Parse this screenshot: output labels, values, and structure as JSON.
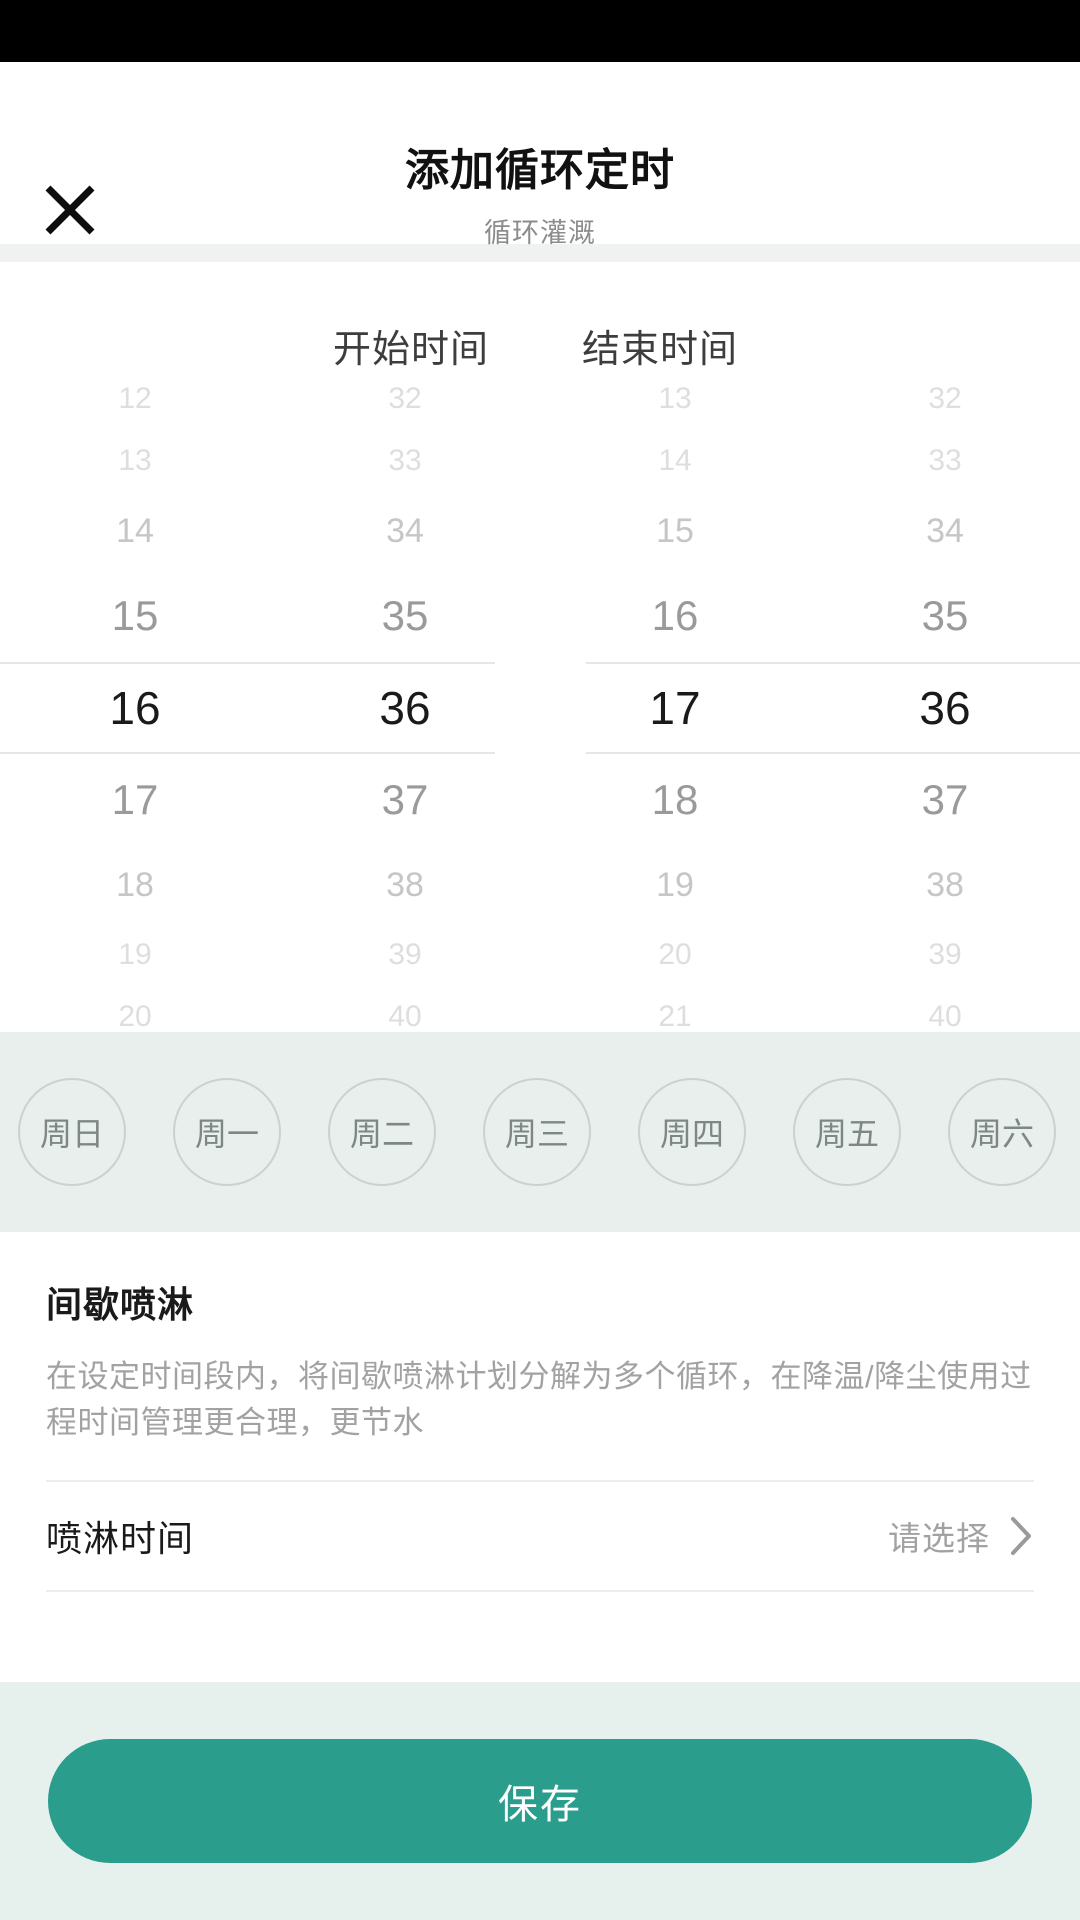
{
  "header": {
    "title": "添加循环定时",
    "subtitle": "循环灌溉",
    "close_icon": "close-icon"
  },
  "picker": {
    "start_label": "开始时间",
    "end_label": "结束时间",
    "start": {
      "hour_selected": "16",
      "minute_selected": "36",
      "hours": [
        "12",
        "13",
        "14",
        "15",
        "16",
        "17",
        "18",
        "19",
        "20"
      ],
      "minutes": [
        "32",
        "33",
        "34",
        "35",
        "36",
        "37",
        "38",
        "39",
        "40"
      ]
    },
    "end": {
      "hour_selected": "17",
      "minute_selected": "36",
      "hours": [
        "13",
        "14",
        "15",
        "16",
        "17",
        "18",
        "19",
        "20",
        "21"
      ],
      "minutes": [
        "32",
        "33",
        "34",
        "35",
        "36",
        "37",
        "38",
        "39",
        "40"
      ]
    }
  },
  "weekdays": {
    "items": [
      {
        "label": "周日",
        "selected": false
      },
      {
        "label": "周一",
        "selected": false
      },
      {
        "label": "周二",
        "selected": false
      },
      {
        "label": "周三",
        "selected": false
      },
      {
        "label": "周四",
        "selected": false
      },
      {
        "label": "周五",
        "selected": false
      },
      {
        "label": "周六",
        "selected": false
      }
    ]
  },
  "spray": {
    "title": "间歇喷淋",
    "description": "在设定时间段内，将间歇喷淋计划分解为多个循环，在降温/降尘使用过程时间管理更合理，更节水",
    "row_label": "喷淋时间",
    "row_value": "请选择",
    "chevron_icon": "chevron-right-icon"
  },
  "footer": {
    "save_label": "保存"
  },
  "colors": {
    "accent": "#2a9d8c",
    "footer_bg": "#e6f1ed",
    "weekday_bg": "#e9efec",
    "muted_text": "#a2a2a2"
  }
}
